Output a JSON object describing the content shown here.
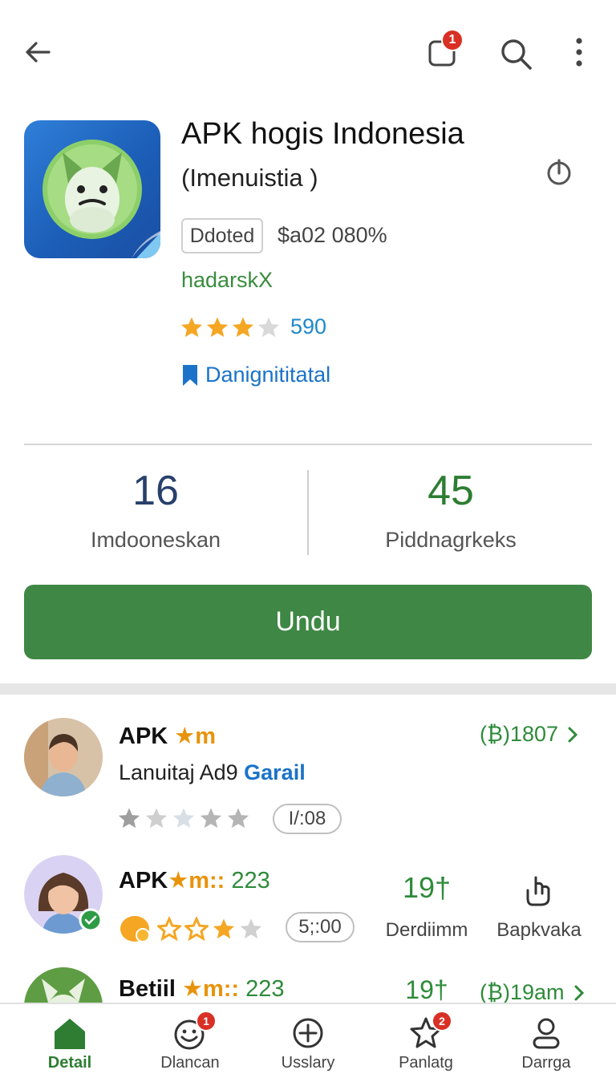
{
  "topbar": {
    "back_icon": "arrow-left-icon",
    "notification_badge": "1",
    "search_icon": "search-icon",
    "more_icon": "more-vert-icon"
  },
  "app": {
    "title": "APK hogis Indonesia",
    "subtitle": "(Imenuistia )",
    "tag": "Ddoted",
    "price": "$a02 080%",
    "developer": "hadarskX",
    "rating_stars": 3,
    "rating_count": "590",
    "wishlist_label": "Danignititatal"
  },
  "stats": {
    "left": {
      "value": "16",
      "label": "Imdooneskan"
    },
    "right": {
      "value": "45",
      "label": "Piddnagrkeks"
    }
  },
  "install_button": "Undu",
  "list": [
    {
      "title": "APK",
      "title_accent": "★m",
      "subtitle_a": "Lanuitaj Ad9",
      "subtitle_b": "Garail",
      "meta": "(₿)1807",
      "stars": 1,
      "pill": "I/:08"
    },
    {
      "title": "APK",
      "title_accent": "★m::",
      "title_extra": "223",
      "pill": "5;:00",
      "col1_num": "19†",
      "col1_lbl": "Derdiimm",
      "col2_lbl": "Bapkvaka"
    },
    {
      "title": "Betiil",
      "title_accent": "★m::",
      "title_extra": "223",
      "col1_num": "19†",
      "meta": "(₿)19am"
    }
  ],
  "bottom_nav": [
    {
      "label": "Detail",
      "icon": "home-icon",
      "active": true
    },
    {
      "label": "Dlancan",
      "icon": "smiley-icon",
      "badge": "1"
    },
    {
      "label": "Usslary",
      "icon": "plus-circle-icon"
    },
    {
      "label": "Panlatg",
      "icon": "star-outline-icon",
      "badge": "2"
    },
    {
      "label": "Darrga",
      "icon": "person-icon"
    }
  ],
  "colors": {
    "primary_green": "#3f8744",
    "link_blue": "#1a73c8",
    "star_gold": "#f5a623",
    "badge_red": "#d93025"
  }
}
